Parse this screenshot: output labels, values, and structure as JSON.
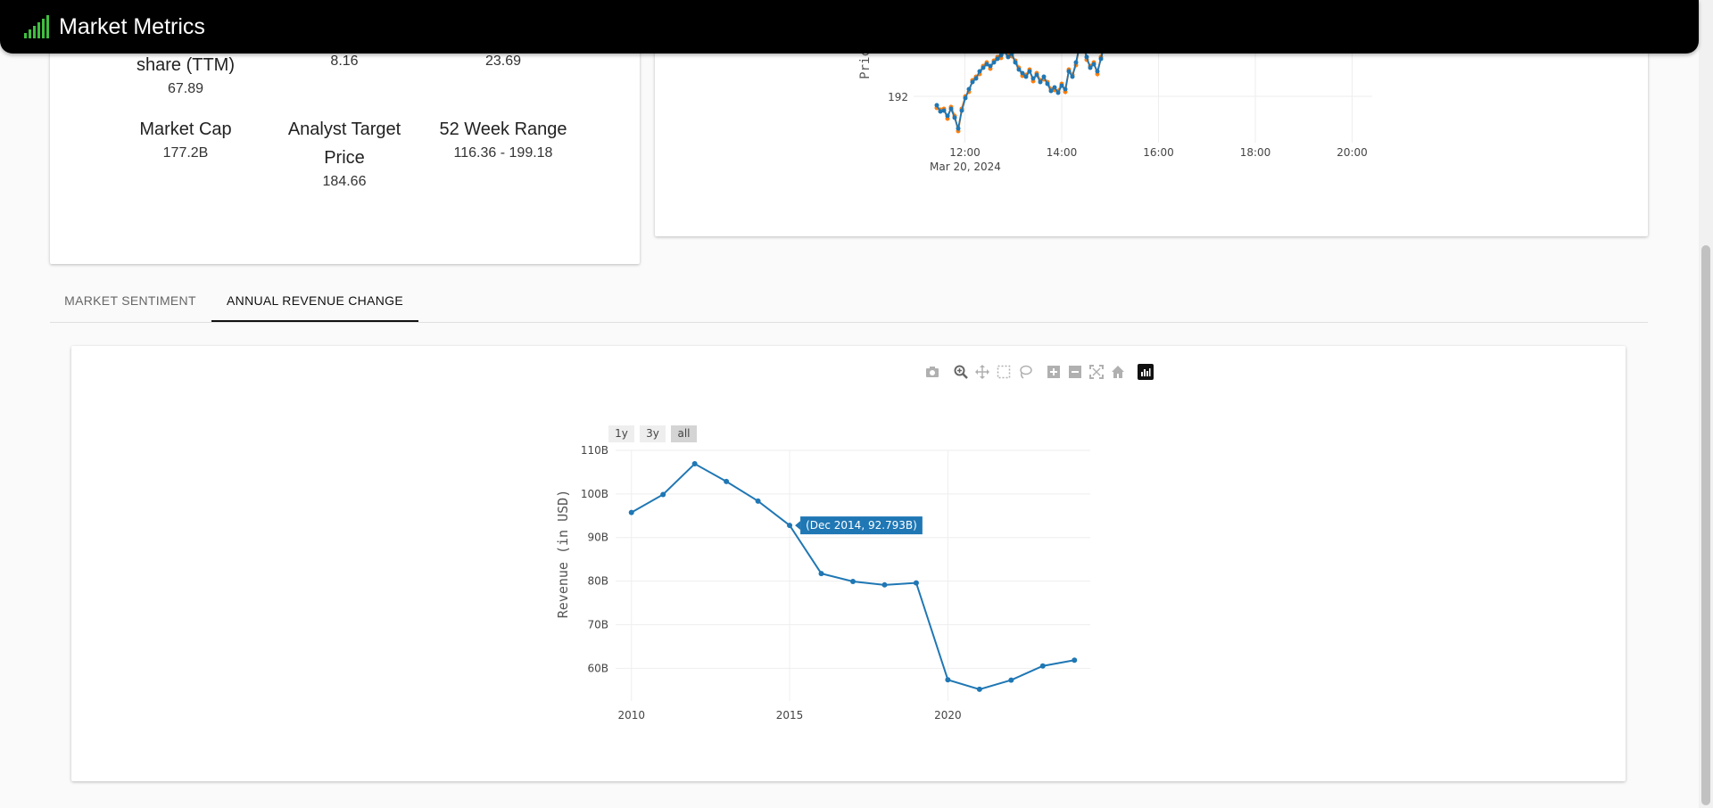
{
  "app": {
    "title": "Market Metrics"
  },
  "metrics": {
    "items": [
      {
        "label": "share (TTM)",
        "value": "67.89"
      },
      {
        "label": "",
        "value": "8.16"
      },
      {
        "label": "",
        "value": "23.69"
      },
      {
        "label": "Market Cap",
        "value": "177.2B"
      },
      {
        "label_line1": "Analyst Target",
        "label_line2": "Price",
        "value": "184.66"
      },
      {
        "label": "52 Week Range",
        "value": "116.36 - 199.18"
      }
    ]
  },
  "price_chart": {
    "ylabel_fragment": "Pric",
    "y_tick": "192",
    "x_ticks": [
      "12:00",
      "14:00",
      "16:00",
      "18:00",
      "20:00"
    ],
    "date_label": "Mar 20, 2024",
    "colors": {
      "series_a": "#1f77b4",
      "series_b": "#ff7f0e"
    }
  },
  "tabs": [
    {
      "label": "MARKET SENTIMENT",
      "selected": false
    },
    {
      "label": "ANNUAL REVENUE CHANGE",
      "selected": true
    }
  ],
  "revenue_chart": {
    "range_buttons": [
      {
        "label": "1y",
        "selected": false
      },
      {
        "label": "3y",
        "selected": false
      },
      {
        "label": "all",
        "selected": true
      }
    ],
    "tooltip": "(Dec 2014, 92.793B)",
    "modebar_icons": [
      "camera-icon",
      "zoom-icon",
      "pan-icon",
      "box-select-icon",
      "lasso-icon",
      "zoom-in-icon",
      "zoom-out-icon",
      "autoscale-icon",
      "reset-axes-icon",
      "plotly-logo-icon"
    ]
  },
  "chart_data": {
    "type": "line",
    "title": "",
    "xlabel": "",
    "ylabel": "Revenue (in USD)",
    "color": "#1f77b4",
    "x": [
      2010,
      2011,
      2012,
      2013,
      2014,
      2015,
      2016,
      2017,
      2018,
      2019,
      2020,
      2021,
      2022,
      2023,
      2024
    ],
    "y": [
      95.76,
      99.87,
      106.92,
      102.87,
      98.37,
      92.79,
      81.74,
      79.92,
      79.14,
      79.59,
      57.35,
      55.18,
      57.29,
      60.53,
      61.86
    ],
    "y_unit": "B",
    "xlim": [
      2009.5,
      2024.5
    ],
    "ylim": [
      52.5,
      110
    ],
    "x_ticks": [
      2010,
      2015,
      2020
    ],
    "y_ticks": [
      60,
      70,
      80,
      90,
      100,
      110
    ],
    "y_tick_labels": [
      "60B",
      "70B",
      "80B",
      "90B",
      "100B",
      "110B"
    ],
    "grid": true
  }
}
